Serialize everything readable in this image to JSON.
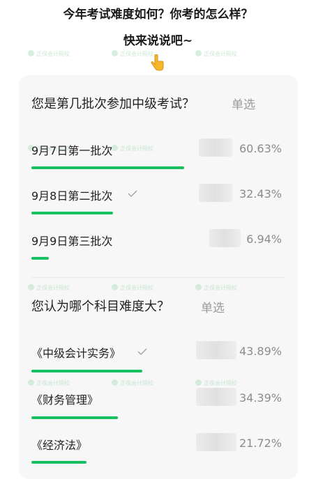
{
  "header": {
    "line1": "今年考试难度如何？你考的怎么样？",
    "line2": "快来说说吧~",
    "pointer_icon": "pointing-down-hand"
  },
  "watermark": "正保会计网校",
  "colors": {
    "bar": "#16c060",
    "percent": "#8c8c8c",
    "type": "#9a9a9a"
  },
  "questions": [
    {
      "title": "您是第几批次参加中级考试？",
      "type": "单选",
      "options": [
        {
          "label": "9月7日第一批次",
          "percent": "60.63%",
          "fraction": 0.6063,
          "selected": false
        },
        {
          "label": "9月8日第二批次",
          "percent": "32.43%",
          "fraction": 0.3243,
          "selected": true
        },
        {
          "label": "9月9日第三批次",
          "percent": "6.94%",
          "fraction": 0.0694,
          "selected": false
        }
      ]
    },
    {
      "title": "您认为哪个科目难度大？",
      "type": "单选",
      "options": [
        {
          "label": "《中级会计实务》",
          "percent": "43.89%",
          "fraction": 0.4389,
          "selected": true
        },
        {
          "label": "《财务管理》",
          "percent": "34.39%",
          "fraction": 0.3439,
          "selected": false
        },
        {
          "label": "《经济法》",
          "percent": "21.72%",
          "fraction": 0.2172,
          "selected": false
        }
      ]
    }
  ]
}
